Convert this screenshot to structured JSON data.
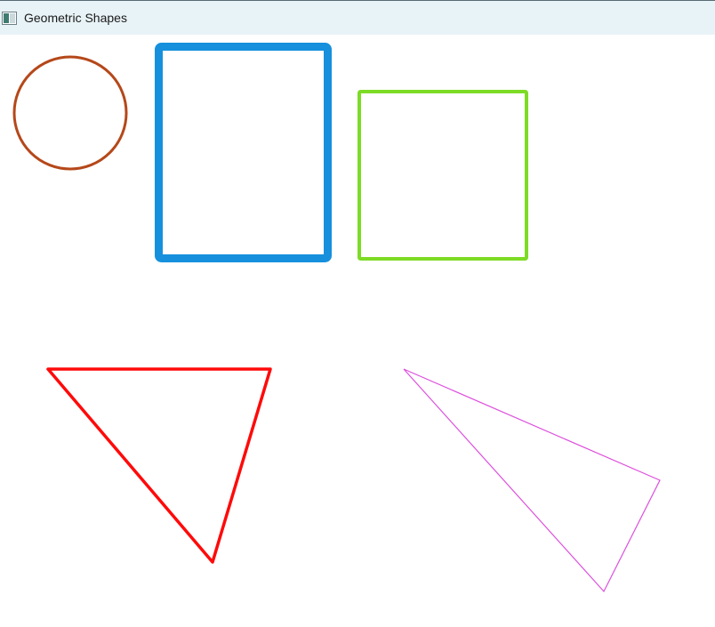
{
  "window": {
    "title": "Geometric Shapes",
    "icon": "window-app-icon"
  },
  "shapes": {
    "circle": {
      "stroke": "#b5481a"
    },
    "tall_rectangle": {
      "stroke": "#1690dd"
    },
    "square": {
      "stroke": "#7ddb25"
    },
    "red_triangle": {
      "stroke": "#ff0a0a"
    },
    "magenta_triangle": {
      "stroke": "#dd4fdd"
    }
  }
}
